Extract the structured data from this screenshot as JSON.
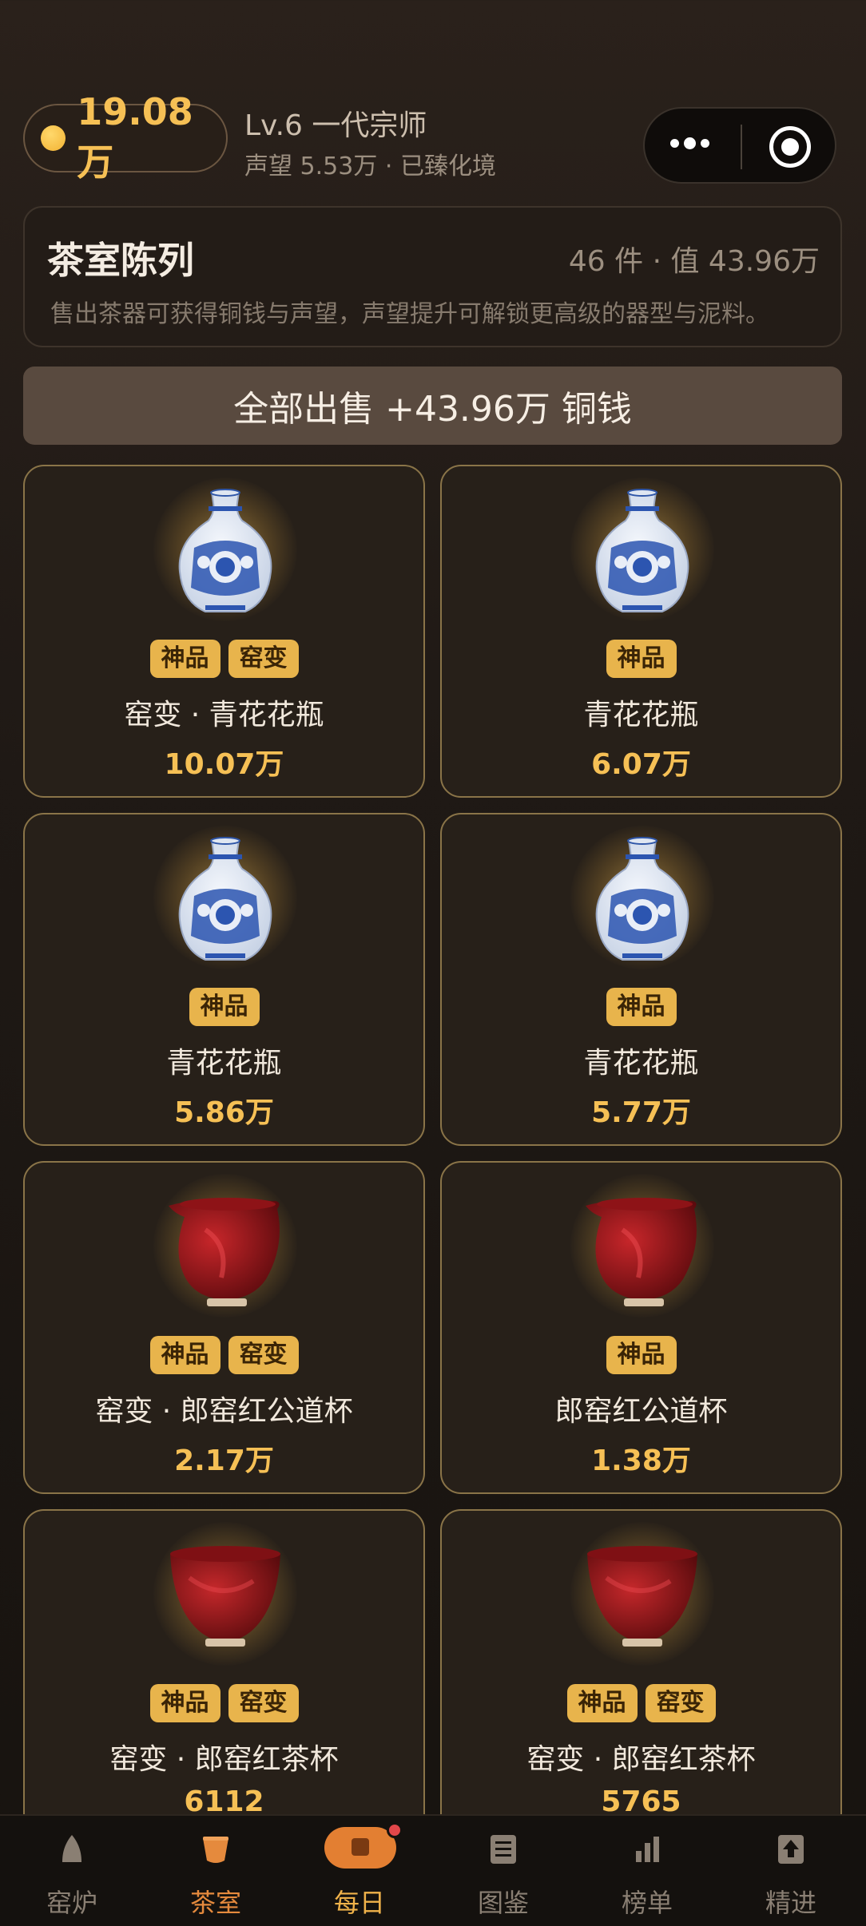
{
  "header": {
    "coins": "19.08万",
    "level": "Lv.6 一代宗师",
    "status": "声望 5.53万 · 已臻化境"
  },
  "panel": {
    "title": "茶室陈列",
    "stats": "46 件 · 值 43.96万",
    "description": "售出茶器可获得铜钱与声望，声望提升可解锁更高级的器型与泥料。"
  },
  "sell_all": "全部出售 +43.96万 铜钱",
  "items": [
    {
      "kind": "vase",
      "badges": [
        "神品",
        "窑变"
      ],
      "name": "窑变 · 青花花瓶",
      "price": "10.07万"
    },
    {
      "kind": "vase",
      "badges": [
        "神品"
      ],
      "name": "青花花瓶",
      "price": "6.07万"
    },
    {
      "kind": "vase",
      "badges": [
        "神品"
      ],
      "name": "青花花瓶",
      "price": "5.86万"
    },
    {
      "kind": "vase",
      "badges": [
        "神品"
      ],
      "name": "青花花瓶",
      "price": "5.77万"
    },
    {
      "kind": "pitcher",
      "badges": [
        "神品",
        "窑变"
      ],
      "name": "窑变 · 郎窑红公道杯",
      "price": "2.17万"
    },
    {
      "kind": "pitcher",
      "badges": [
        "神品"
      ],
      "name": "郎窑红公道杯",
      "price": "1.38万"
    },
    {
      "kind": "cup",
      "badges": [
        "神品",
        "窑变"
      ],
      "name": "窑变 · 郎窑红茶杯",
      "price": "6112"
    },
    {
      "kind": "cup",
      "badges": [
        "神品",
        "窑变"
      ],
      "name": "窑变 · 郎窑红茶杯",
      "price": "5765"
    }
  ],
  "tabs": [
    {
      "label": "窑炉",
      "icon": "kiln-icon"
    },
    {
      "label": "茶室",
      "icon": "teacup-icon"
    },
    {
      "label": "每日",
      "icon": "daily-icon"
    },
    {
      "label": "图鉴",
      "icon": "catalog-icon"
    },
    {
      "label": "榜单",
      "icon": "ranking-icon"
    },
    {
      "label": "精进",
      "icon": "upgrade-icon"
    }
  ],
  "colors": {
    "accent_gold": "#f6c055",
    "badge": "#e8b44c",
    "active_tab": "#e58a3d",
    "background": "#1f1915"
  }
}
